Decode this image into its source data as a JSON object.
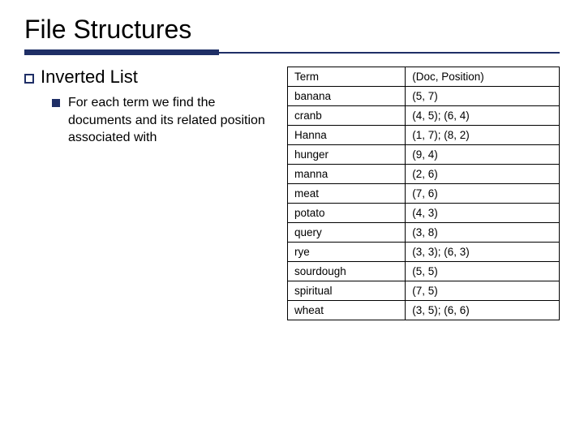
{
  "title": "File Structures",
  "section_heading": "Inverted List",
  "sub_text": "For each term we find the documents and its related position associated with",
  "table": {
    "header": {
      "col1": "Term",
      "col2": "(Doc, Position)"
    },
    "rows": [
      {
        "term": "banana",
        "pos": "(5, 7)"
      },
      {
        "term": "cranb",
        "pos": "(4, 5); (6, 4)"
      },
      {
        "term": "Hanna",
        "pos": "(1, 7); (8, 2)"
      },
      {
        "term": "hunger",
        "pos": "(9, 4)"
      },
      {
        "term": "manna",
        "pos": "(2, 6)"
      },
      {
        "term": "meat",
        "pos": "(7, 6)"
      },
      {
        "term": "potato",
        "pos": "(4, 3)"
      },
      {
        "term": "query",
        "pos": "(3, 8)"
      },
      {
        "term": "rye",
        "pos": "(3, 3); (6, 3)"
      },
      {
        "term": "sourdough",
        "pos": "(5, 5)"
      },
      {
        "term": "spiritual",
        "pos": "(7, 5)"
      },
      {
        "term": "wheat",
        "pos": "(3, 5); (6, 6)"
      }
    ]
  }
}
